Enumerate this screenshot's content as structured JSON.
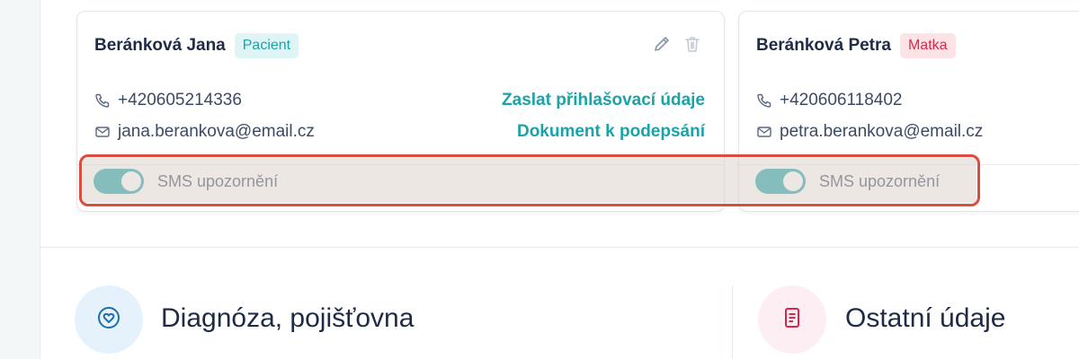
{
  "contacts": [
    {
      "name": "Beránková Jana",
      "badge": "Pacient",
      "phone": "+420605214336",
      "email": "jana.berankova@email.cz",
      "links": [
        "Zaslat přihlašovací údaje",
        "Dokument k podepsání"
      ],
      "sms_label": "SMS upozornění",
      "sms_enabled": true
    },
    {
      "name": "Beránková Petra",
      "badge": "Matka",
      "phone": "+420606118402",
      "email": "petra.berankova@email.cz",
      "sms_label": "SMS upozornění",
      "sms_enabled": true
    }
  ],
  "icons": {
    "edit": "pencil-icon",
    "delete": "trash-icon",
    "phone": "phone-icon",
    "email": "envelope-icon",
    "diagnosis": "heart-icon",
    "other": "document-icon"
  },
  "sections": [
    {
      "title": "Diagnóza, pojišťovna"
    },
    {
      "title": "Ostatní údaje"
    }
  ],
  "colors": {
    "accent": "#1aa3a8",
    "patient_badge_bg": "#dff4f4",
    "mother_badge_bg": "#fde3e6",
    "mother_badge_text": "#d6294a",
    "highlight_border": "#dd4a3e"
  }
}
